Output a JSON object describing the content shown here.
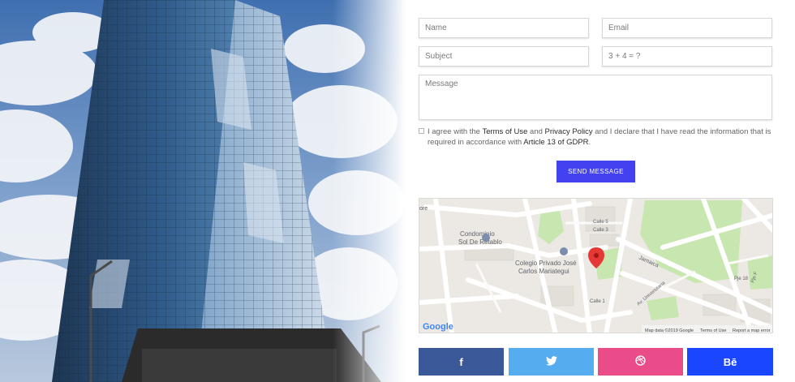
{
  "form": {
    "name_placeholder": "Name",
    "email_placeholder": "Email",
    "subject_placeholder": "Subject",
    "captcha_placeholder": "3 + 4 = ?",
    "message_placeholder": "Message",
    "agree_prefix": "I agree with the ",
    "terms_link": "Terms of Use",
    "agree_and": " and ",
    "privacy_link": "Privacy Policy",
    "agree_middle": " and I declare that I have read the information that is required in accordance with ",
    "article_link": "Article 13 of GDPR",
    "agree_suffix": ".",
    "send_label": "SEND MESSAGE"
  },
  "map": {
    "place1_line1": "Condominio",
    "place1_line2": "Sol De Retablo",
    "place2_line1": "Colegio Privado José",
    "place2_line2": "Carlos Mariategui",
    "street_jamaica": "Jamaica",
    "street_calle1": "Calle 1",
    "street_calle3": "Calle 3",
    "street_universitaria": "Av. Universitaria",
    "street_pje18": "Pje 18",
    "street_pje_f": "Pje F",
    "street_cinco": "Calle 5",
    "street_ore": "ore",
    "google_logo": "Google",
    "map_data": "Map data ©2019 Google",
    "terms": "Terms of Use",
    "report": "Report a map error"
  },
  "social": {
    "facebook": "f",
    "twitter": "🐦",
    "dribbble": "◉",
    "behance": "Bē",
    "colors": {
      "facebook": "#3b5998",
      "twitter": "#55acee",
      "dribbble": "#ea4c89",
      "behance": "#1a46ff"
    }
  },
  "colors": {
    "accent": "#4242f0",
    "map_pin": "#e53935",
    "park": "#c8e6b0"
  },
  "icons": {
    "map_pin": "map-pin-icon",
    "poi": "poi-icon"
  }
}
